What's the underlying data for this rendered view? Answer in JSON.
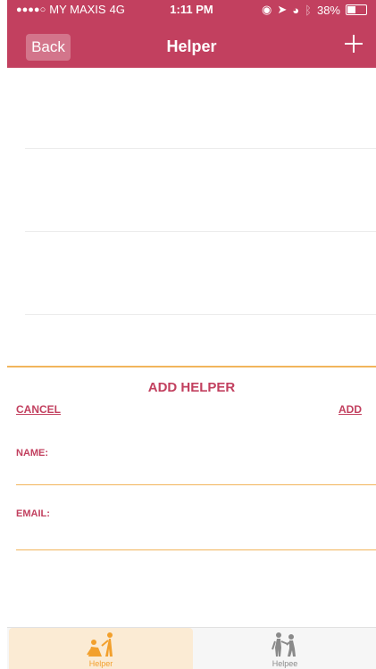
{
  "status_bar": {
    "carrier": "MY MAXIS",
    "network": "4G",
    "time": "1:11 PM",
    "battery": "38%"
  },
  "nav": {
    "back_label": "Back",
    "title": "Helper",
    "add_icon": "plus-icon"
  },
  "panel": {
    "title": "ADD HELPER",
    "cancel_label": "CANCEL",
    "add_label": "ADD",
    "name_label": "NAME:",
    "name_value": "",
    "email_label": "EMAIL:",
    "email_value": ""
  },
  "tabs": [
    {
      "label": "Helper",
      "icon": "helper-icon",
      "active": true
    },
    {
      "label": "Helpee",
      "icon": "helpee-icon",
      "active": false
    }
  ],
  "colors": {
    "primary": "#c2405f",
    "accent": "#f2b55c",
    "tab_active_bg": "#fbebd4",
    "tab_active_text": "#f2a02d"
  }
}
